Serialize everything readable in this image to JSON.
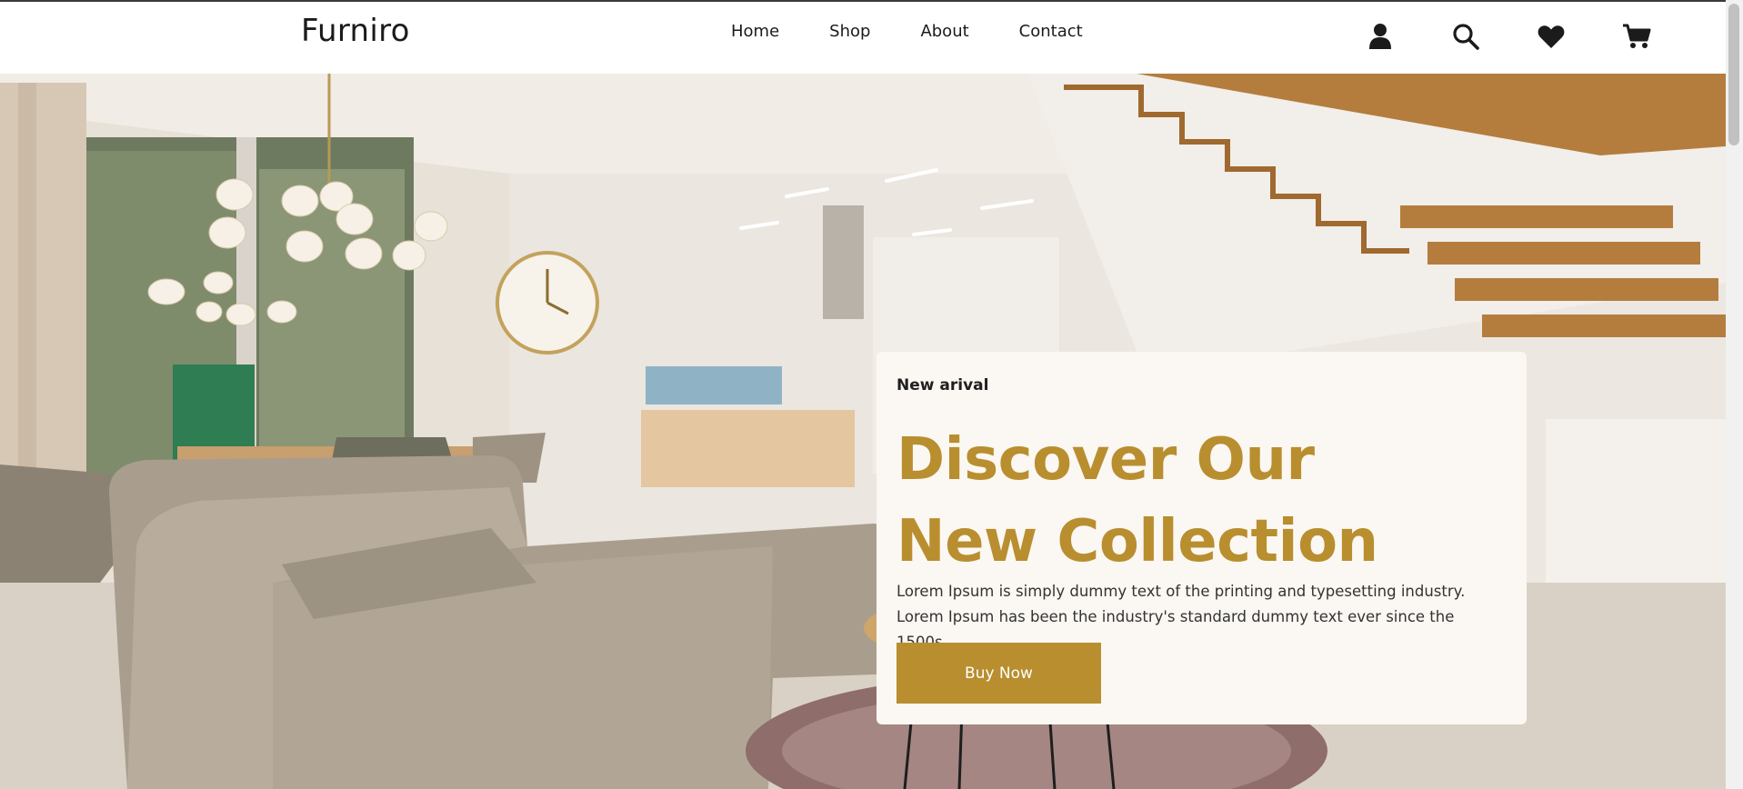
{
  "brand": {
    "name": "Furniro"
  },
  "nav": {
    "links": [
      "Home",
      "Shop",
      "About",
      "Contact"
    ],
    "icons": [
      "user-icon",
      "search-icon",
      "heart-icon",
      "cart-icon"
    ]
  },
  "hero": {
    "eyebrow": "New arival",
    "title_line1": "Discover Our",
    "title_line2": "New Collection",
    "description": "Lorem Ipsum is simply dummy text of the printing and typesetting industry. Lorem Ipsum has been the industry's standard dummy text ever since the 1500s,",
    "cta_label": "Buy Now"
  },
  "colors": {
    "accent": "#b88e2f",
    "card_bg": "#fbf7f2",
    "text_dark": "#1f1f1f"
  }
}
